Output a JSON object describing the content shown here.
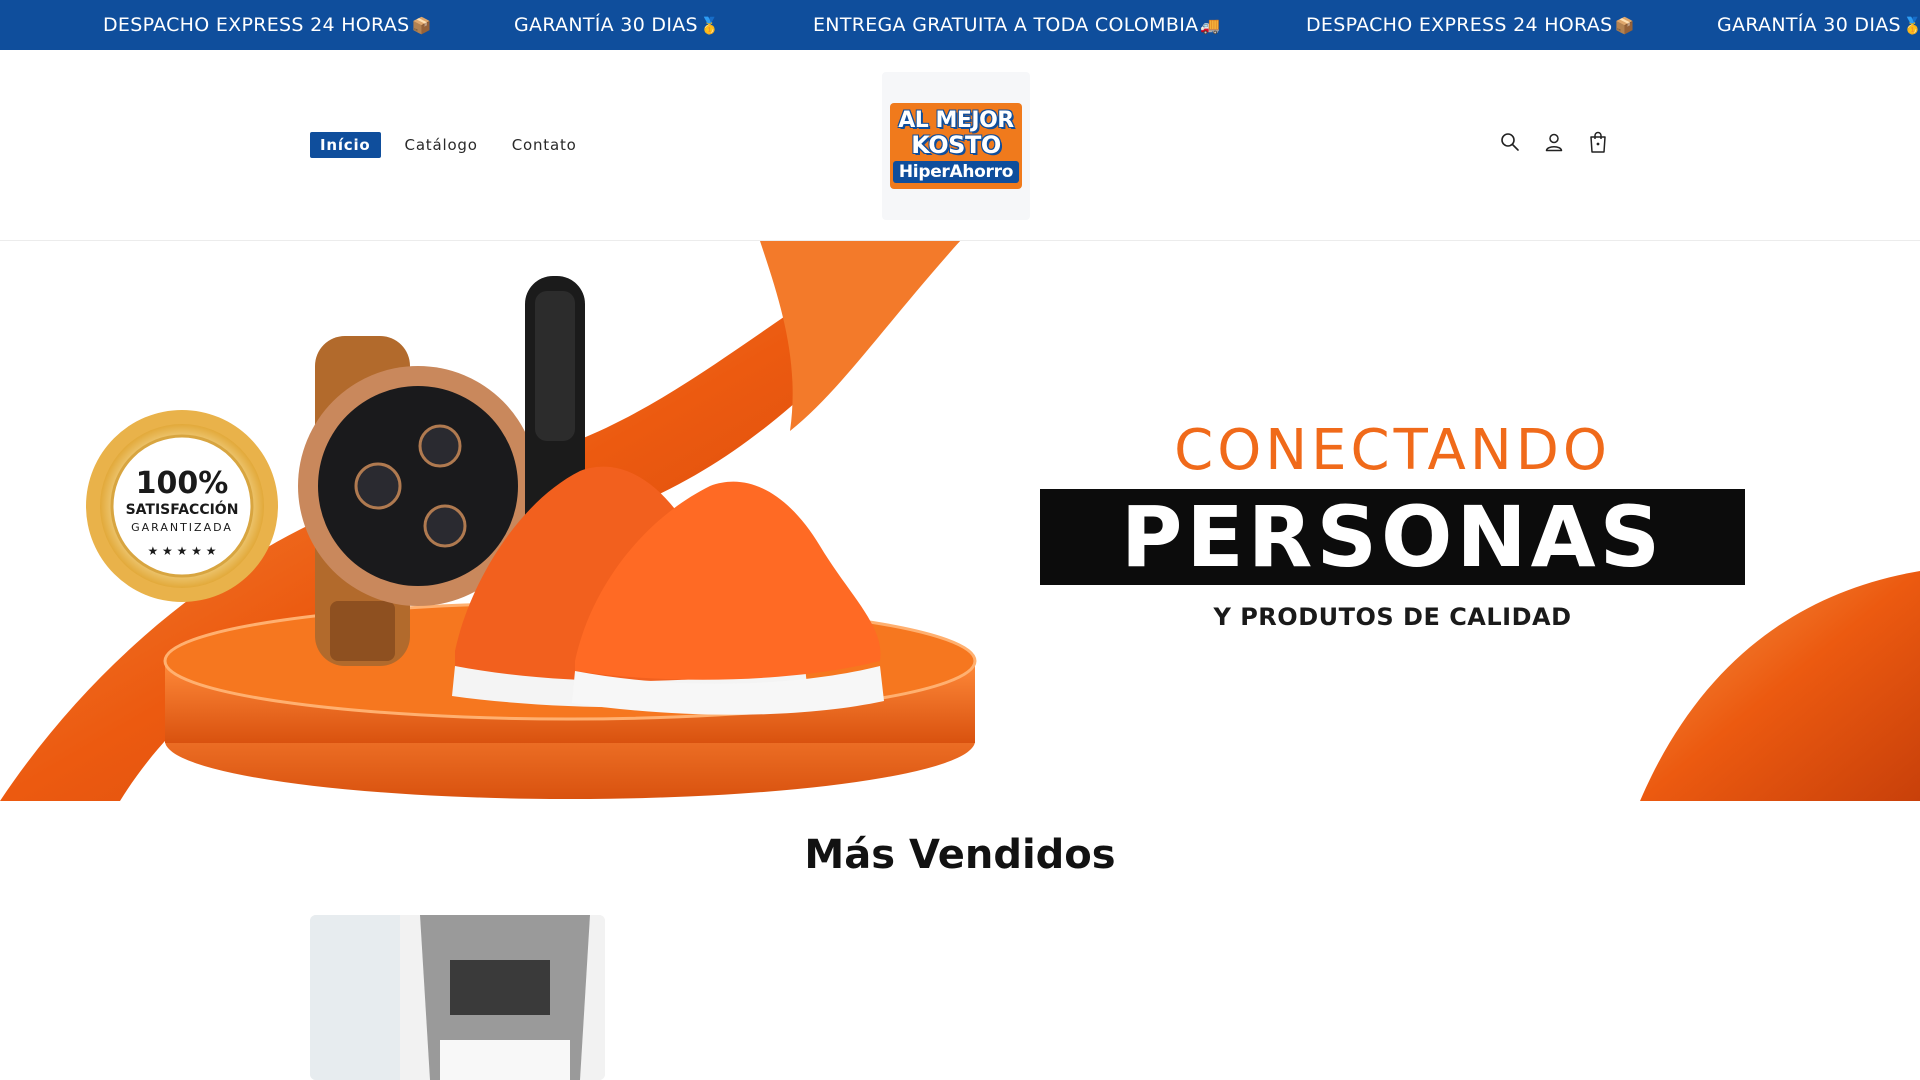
{
  "announcement": {
    "items": [
      {
        "text": "DESPACHO EXPRESS 24 HORAS",
        "emoji": "📦"
      },
      {
        "text": "GARANTÍA 30 DIAS",
        "emoji": "🥇"
      },
      {
        "text": "ENTREGA GRATUITA A TODA COLOMBIA",
        "emoji": "🚚"
      },
      {
        "text": "DESPACHO EXPRESS 24 HORAS",
        "emoji": "📦"
      },
      {
        "text": "GARANTÍA 30 DIAS",
        "emoji": "🥇"
      }
    ]
  },
  "header": {
    "nav": [
      {
        "label": "Início",
        "active": true
      },
      {
        "label": "Catálogo",
        "active": false
      },
      {
        "label": "Contato",
        "active": false
      }
    ],
    "logo": {
      "line1": "AL MEJOR",
      "line2": "KOSTO",
      "line3": "HiperAhorro"
    },
    "icons": [
      "search-icon",
      "account-icon",
      "cart-icon"
    ]
  },
  "hero": {
    "line1": "CONECTANDO",
    "line2": "PERSONAS",
    "line3": "Y PRODUTOS DE CALIDAD",
    "badge": {
      "line1": "100%",
      "line2": "SATISFACCIÓN",
      "line3": "GARANTIZADA"
    },
    "colors": {
      "accent": "#f06a1a",
      "primary": "#0f4e9c"
    }
  },
  "section": {
    "title": "Más Vendidos"
  }
}
